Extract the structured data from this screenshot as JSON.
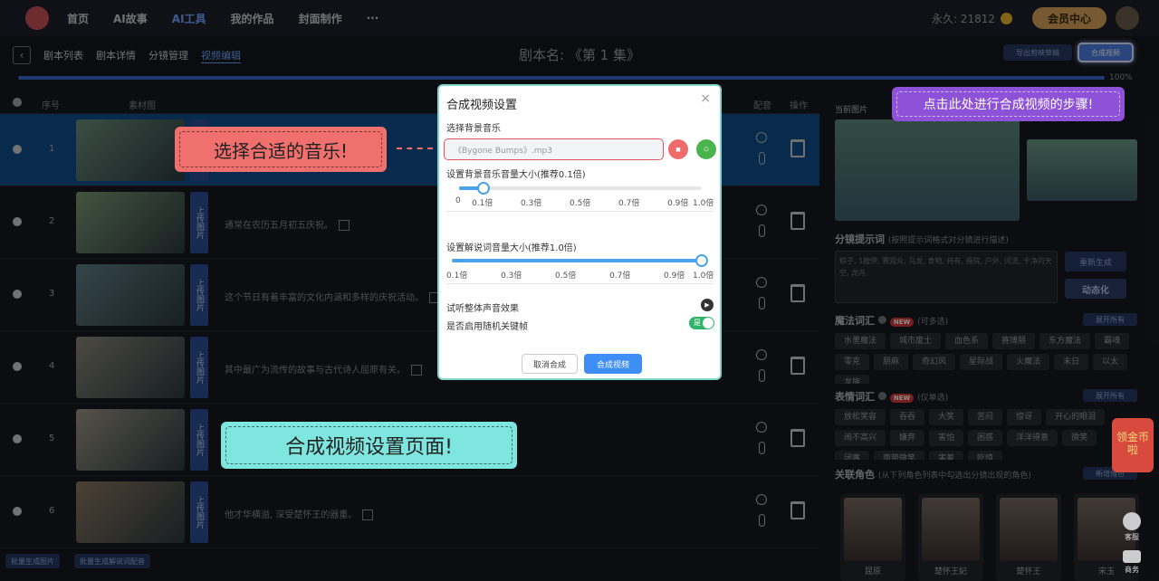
{
  "nav": {
    "items": [
      "首页",
      "AI故事",
      "AI工具",
      "我的作品",
      "封面制作",
      "···"
    ],
    "active_index": 2,
    "points": "永久: 21812",
    "vip": "会员中心"
  },
  "subnav": {
    "crumbs": [
      "剧本列表",
      "剧本详情",
      "分镜管理",
      "视频编辑"
    ],
    "active_index": 3,
    "script_title": "剧本名: 《第 1 集》",
    "export": "导出剪映草稿",
    "compose": "合成视频",
    "progress_label": "100%"
  },
  "table": {
    "headers": [
      "序号",
      "素材图",
      "配音",
      "操作"
    ],
    "upload_label": "上传图片",
    "rows": [
      {
        "num": "1",
        "desc": ""
      },
      {
        "num": "2",
        "desc": "通常在农历五月初五庆祝。"
      },
      {
        "num": "3",
        "desc": "这个节日有着丰富的文化内涵和多样的庆祝活动。"
      },
      {
        "num": "4",
        "desc": "其中最广为流传的故事与古代诗人屈原有关。"
      },
      {
        "num": "5",
        "desc": ""
      },
      {
        "num": "6",
        "desc": "他才华横溢, 深受楚怀王的器重。"
      }
    ],
    "bottom_buttons": [
      "批量生成图片",
      "批量生成解说词配音"
    ]
  },
  "side": {
    "current_image": "当前图片",
    "prompt_title": "分镜提示词",
    "prompt_sub": "(按照提示词格式对分镜进行描述)",
    "prompt_text": "粽子, 1艘伊, 赛观众, 马龙, 食物, 持有, 画院, 户外, 词流, 干净的天空, 龙舟,",
    "regen": "重新生成",
    "animate": "动态化",
    "magic_title": "魔法词汇",
    "magic_sub": "(可多选)",
    "new_badge": "NEW",
    "expand_all": "展开所有",
    "magic_tags": [
      "水墨魔法",
      "城市废土",
      "血色系",
      "赛博朋",
      "东方魔法",
      "霸魂",
      "零克",
      "朋麻",
      "奇幻风",
      "星际战",
      "火魔法",
      "末日",
      "以太",
      "龙族"
    ],
    "emo_title": "表情词汇",
    "emo_sub": "(仅单选)",
    "emo_tags": [
      "放松笑容",
      "吞吞",
      "大笑",
      "苦闷",
      "惊讶",
      "开心的眼泪",
      "闹不高兴",
      "嫌弃",
      "害怕",
      "困惑",
      "洋洋得意",
      "微笑",
      "闭嘴",
      "面带微笑",
      "害羞",
      "吃惊"
    ],
    "role_title": "关联角色",
    "role_sub": "(从下列角色列表中勾选出分镜出现的角色)",
    "new_role": "新增角色",
    "roles": [
      "屈原",
      "楚怀王妃",
      "楚怀王",
      "宋玉"
    ]
  },
  "modal": {
    "title": "合成视频设置",
    "close": "×",
    "music_label": "选择背景音乐",
    "music_value": "《Bygone Bumps》.mp3",
    "bg_volume_label": "设置背景音乐音量大小(推荐0.1倍)",
    "bg_ticks": [
      "0",
      "0.1倍",
      "0.3倍",
      "0.5倍",
      "0.7倍",
      "0.9倍",
      "1.0倍"
    ],
    "bg_volume_value": 0.1,
    "voice_volume_label": "设置解说词音量大小(推荐1.0倍)",
    "voice_ticks": [
      "0.1倍",
      "0.3倍",
      "0.5倍",
      "0.7倍",
      "0.9倍",
      "1.0倍"
    ],
    "voice_volume_value": 1.0,
    "preview_label": "试听整体声音效果",
    "random_label": "是否启用随机关键帧",
    "toggle_text": "是",
    "cancel": "取消合成",
    "confirm": "合成视频"
  },
  "callouts": {
    "music": "选择合适的音乐!",
    "page": "合成视频设置页面!",
    "step": "点击此处进行合成视频的步骤!"
  },
  "float": {
    "package": "领金币啦",
    "customer": "客服",
    "business": "商务"
  }
}
